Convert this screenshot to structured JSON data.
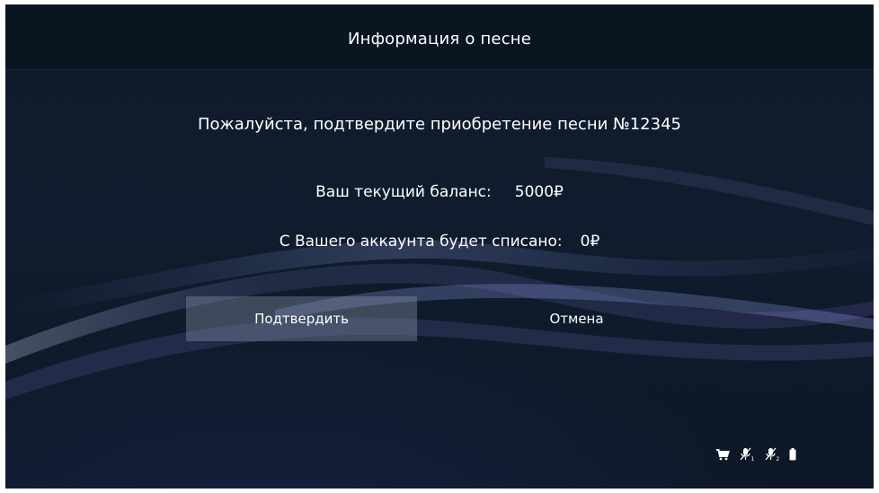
{
  "header": {
    "title": "Информация о песне"
  },
  "dialog": {
    "question": "Пожалуйста, подтвердите приобретение песни №12345",
    "balance_label": "Ваш текущий баланс:",
    "balance_value": "5000₽",
    "charge_label": "С Вашего аккаунта будет списано:",
    "charge_value": "0₽"
  },
  "buttons": {
    "confirm_label": "Подтвердить",
    "cancel_label": "Отмена"
  },
  "status_bar": {
    "icons": [
      "cart-icon",
      "mic-1-muted-icon",
      "mic-2-muted-icon",
      "battery-icon"
    ],
    "mic1_index": "1",
    "mic2_index": "2"
  },
  "colors": {
    "background": "#0f1b2b",
    "text": "#ffffff",
    "button_highlight": "#8c96aa"
  }
}
